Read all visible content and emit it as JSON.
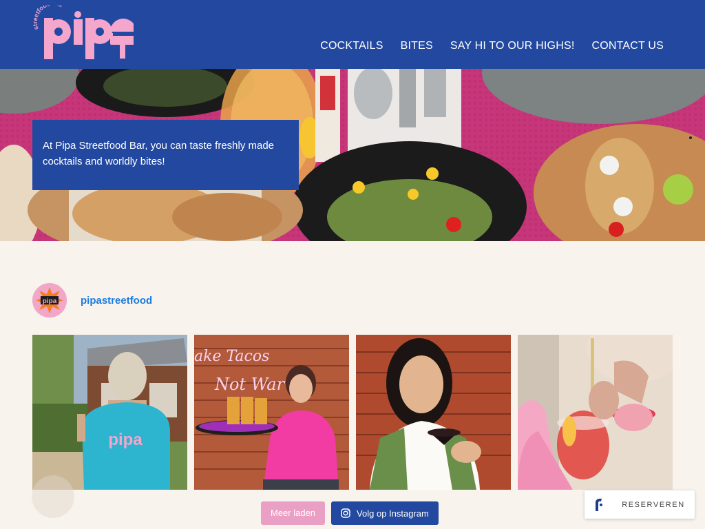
{
  "header": {
    "logo_alt": "Pipa streetfood bar",
    "logo_tagline": "streetfood bar",
    "logo_word": "pipa",
    "nav": [
      {
        "label": "COCKTAILS"
      },
      {
        "label": "BITES"
      },
      {
        "label": "SAY HI TO OUR HIGHS!"
      },
      {
        "label": "CONTACT US"
      }
    ]
  },
  "hero": {
    "text": "At Pipa Streetfood Bar, you can taste freshly made cocktails and worldly bites!"
  },
  "instagram": {
    "username": "pipastreetfood",
    "load_more": "Meer laden",
    "follow": "Volg op Instagram",
    "neon_text_1": "ake Tacos",
    "neon_text_2": "Not War"
  },
  "reserve": {
    "label": "RESERVEREN"
  },
  "colors": {
    "brand_blue": "#2348a0",
    "brand_pink": "#ea9fc4",
    "link_blue": "#1b7be0",
    "background": "#f8f3ec"
  }
}
